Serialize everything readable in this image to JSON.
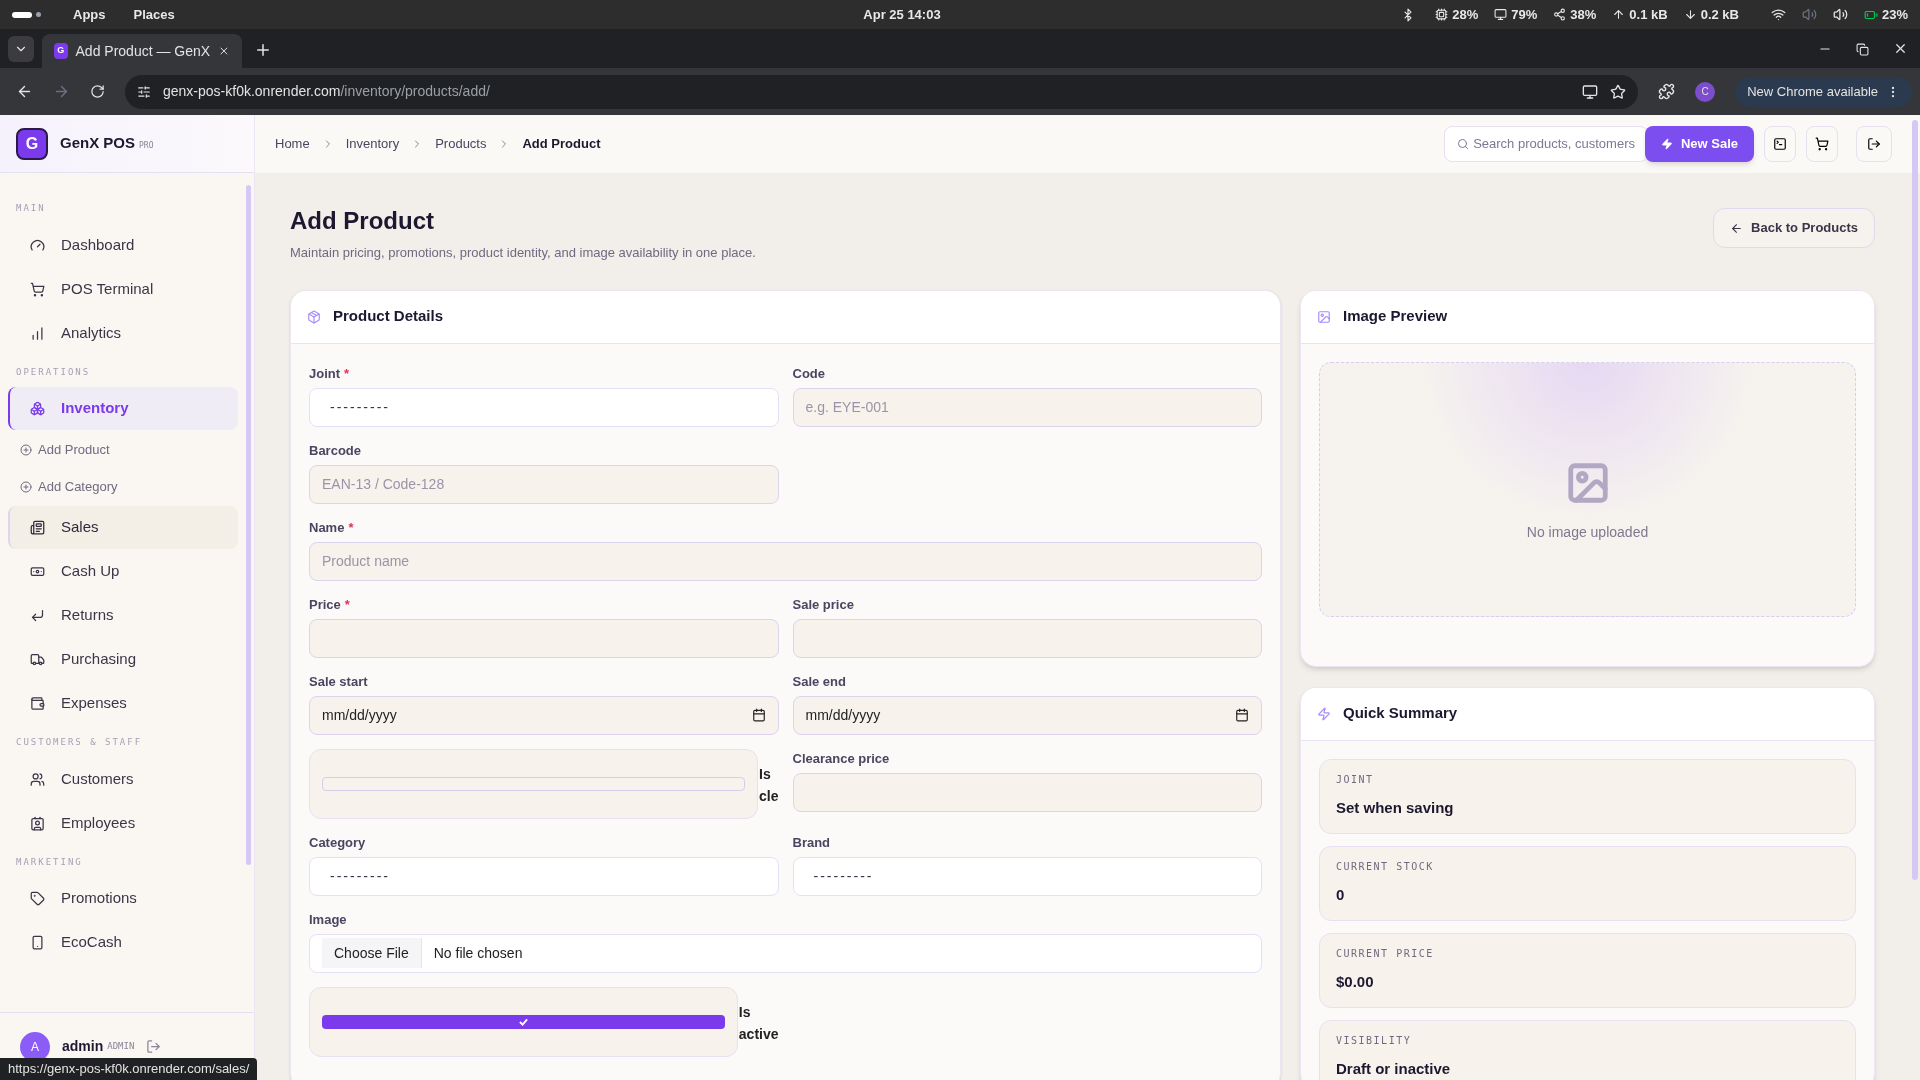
{
  "system_bar": {
    "menus": [
      "Apps",
      "Places"
    ],
    "clock": "Apr 25  14:03",
    "indicators": [
      "28%",
      "79%",
      "38%",
      "0.1 kB",
      "0.2 kB",
      "23%"
    ]
  },
  "browser": {
    "tab_favicon": "G",
    "tab_title": "Add Product — GenX",
    "url_host": "genx-pos-kf0k.onrender.com",
    "url_path": "/inventory/products/add/",
    "profile_initial": "C",
    "update_button": "New Chrome available"
  },
  "sidebar": {
    "logo_letter": "G",
    "brand": "GenX POS",
    "brand_badge": "PRO",
    "sections": [
      {
        "title": "MAIN",
        "items": [
          {
            "kind": "item",
            "label": "Dashboard",
            "selected": false,
            "hovered": false
          },
          {
            "kind": "item",
            "label": "POS Terminal",
            "selected": false,
            "hovered": false
          },
          {
            "kind": "item",
            "label": "Analytics",
            "selected": false,
            "hovered": false
          }
        ]
      },
      {
        "title": "OPERATIONS",
        "items": [
          {
            "kind": "item",
            "label": "Inventory",
            "selected": true,
            "hovered": false
          },
          {
            "kind": "subitem",
            "label": "Add Product",
            "selected": false,
            "hovered": false
          },
          {
            "kind": "subitem",
            "label": "Add Category",
            "selected": false,
            "hovered": false
          },
          {
            "kind": "item",
            "label": "Sales",
            "selected": false,
            "hovered": true
          },
          {
            "kind": "item",
            "label": "Cash Up",
            "selected": false,
            "hovered": false
          },
          {
            "kind": "item",
            "label": "Returns",
            "selected": false,
            "hovered": false
          },
          {
            "kind": "item",
            "label": "Purchasing",
            "selected": false,
            "hovered": false
          },
          {
            "kind": "item",
            "label": "Expenses",
            "selected": false,
            "hovered": false
          }
        ]
      },
      {
        "title": "CUSTOMERS & STAFF",
        "items": [
          {
            "kind": "item",
            "label": "Customers",
            "selected": false,
            "hovered": false
          },
          {
            "kind": "item",
            "label": "Employees",
            "selected": false,
            "hovered": false
          }
        ]
      },
      {
        "title": "MARKETING",
        "items": [
          {
            "kind": "item",
            "label": "Promotions",
            "selected": false,
            "hovered": false
          },
          {
            "kind": "item",
            "label": "EcoCash",
            "selected": false,
            "hovered": false
          }
        ]
      }
    ],
    "user": {
      "initial": "A",
      "name": "admin",
      "role": "ADMIN"
    }
  },
  "header": {
    "breadcrumbs": [
      {
        "label": "Home",
        "selected": false
      },
      {
        "label": "Inventory",
        "selected": false
      },
      {
        "label": "Products",
        "selected": false
      },
      {
        "label": "Add Product",
        "selected": true
      }
    ],
    "search": {
      "placeholder": "Search products, customers"
    },
    "new_sale": "New Sale"
  },
  "page": {
    "title": "Add Product",
    "subtitle": "Maintain pricing, promotions, product identity, and image availability in one place.",
    "back_button": "Back to Products"
  },
  "product_details": {
    "title": "Product Details",
    "rows": [
      [
        {
          "kind": "select",
          "label": "Joint",
          "required_mark": "*",
          "value": "---------"
        },
        {
          "kind": "input",
          "label": "Code",
          "placeholder": "e.g. EYE-001"
        }
      ],
      [
        {
          "kind": "input",
          "label": "Barcode",
          "placeholder": "EAN-13 / Code-128"
        }
      ],
      [
        {
          "kind": "input",
          "label": "Name",
          "required_mark": "*",
          "placeholder": "Product name",
          "wide": true
        }
      ],
      [
        {
          "kind": "input",
          "label": "Price",
          "required_mark": "*"
        },
        {
          "kind": "input",
          "label": "Sale price"
        }
      ],
      [
        {
          "kind": "date",
          "label": "Sale start",
          "value": "mm/dd/yyyy"
        },
        {
          "kind": "date",
          "label": "Sale end",
          "value": "mm/dd/yyyy"
        }
      ],
      [
        {
          "kind": "checkbox",
          "label": "Is cle",
          "checked": false
        },
        {
          "kind": "input",
          "label": "Clearance price"
        }
      ],
      [
        {
          "kind": "select",
          "label": "Category",
          "value": "---------"
        },
        {
          "kind": "select",
          "label": "Brand",
          "value": "---------"
        }
      ],
      [
        {
          "kind": "file",
          "label": "Image",
          "button": "Choose File",
          "value": "No file chosen",
          "wide": true
        }
      ],
      [
        {
          "kind": "checkbox",
          "label": "Is active",
          "checked": true
        }
      ]
    ]
  },
  "image_preview": {
    "title": "Image Preview",
    "empty_text": "No image uploaded"
  },
  "quick_summary": {
    "title": "Quick Summary",
    "items": [
      {
        "label": "JOINT",
        "value": "Set when saving"
      },
      {
        "label": "CURRENT STOCK",
        "value": "0"
      },
      {
        "label": "CURRENT PRICE",
        "value": "$0.00"
      },
      {
        "label": "VISIBILITY",
        "value": "Draft or inactive"
      }
    ]
  },
  "status_url": "https://genx-pos-kf0k.onrender.com/sales/"
}
